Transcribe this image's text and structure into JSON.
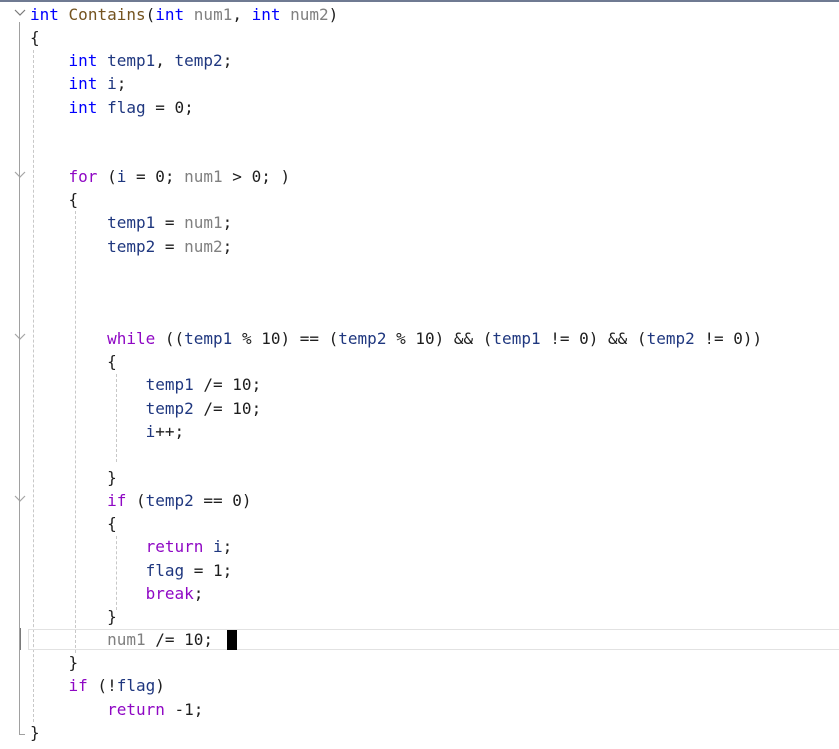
{
  "editor": {
    "colors": {
      "keyword": "#0000ff",
      "control": "#8f08c4",
      "function": "#74531f",
      "parameter": "#808080",
      "local": "#1f377f",
      "text": "#1e1e1e"
    },
    "lines": [
      {
        "tokens": [
          {
            "t": "int",
            "c": "keyword"
          },
          {
            "t": " "
          },
          {
            "t": "Contains",
            "c": "func"
          },
          {
            "t": "("
          },
          {
            "t": "int",
            "c": "keyword"
          },
          {
            "t": " "
          },
          {
            "t": "num1",
            "c": "param"
          },
          {
            "t": ", "
          },
          {
            "t": "int",
            "c": "keyword"
          },
          {
            "t": " "
          },
          {
            "t": "num2",
            "c": "param"
          },
          {
            "t": ")"
          }
        ]
      },
      {
        "tokens": [
          {
            "t": "{"
          }
        ]
      },
      {
        "tokens": [
          {
            "t": "    "
          },
          {
            "t": "int",
            "c": "keyword"
          },
          {
            "t": " "
          },
          {
            "t": "temp1",
            "c": "local"
          },
          {
            "t": ", "
          },
          {
            "t": "temp2",
            "c": "local"
          },
          {
            "t": ";"
          }
        ]
      },
      {
        "tokens": [
          {
            "t": "    "
          },
          {
            "t": "int",
            "c": "keyword"
          },
          {
            "t": " "
          },
          {
            "t": "i",
            "c": "local"
          },
          {
            "t": ";"
          }
        ]
      },
      {
        "tokens": [
          {
            "t": "    "
          },
          {
            "t": "int",
            "c": "keyword"
          },
          {
            "t": " "
          },
          {
            "t": "flag",
            "c": "local"
          },
          {
            "t": " = 0;"
          }
        ]
      },
      {
        "tokens": []
      },
      {
        "tokens": []
      },
      {
        "tokens": [
          {
            "t": "    "
          },
          {
            "t": "for",
            "c": "control"
          },
          {
            "t": " ("
          },
          {
            "t": "i",
            "c": "local"
          },
          {
            "t": " = 0; "
          },
          {
            "t": "num1",
            "c": "param"
          },
          {
            "t": " > 0; )"
          }
        ]
      },
      {
        "tokens": [
          {
            "t": "    {"
          }
        ]
      },
      {
        "tokens": [
          {
            "t": "        "
          },
          {
            "t": "temp1",
            "c": "local"
          },
          {
            "t": " = "
          },
          {
            "t": "num1",
            "c": "param"
          },
          {
            "t": ";"
          }
        ]
      },
      {
        "tokens": [
          {
            "t": "        "
          },
          {
            "t": "temp2",
            "c": "local"
          },
          {
            "t": " = "
          },
          {
            "t": "num2",
            "c": "param"
          },
          {
            "t": ";"
          }
        ]
      },
      {
        "tokens": []
      },
      {
        "tokens": []
      },
      {
        "tokens": []
      },
      {
        "tokens": [
          {
            "t": "        "
          },
          {
            "t": "while",
            "c": "control"
          },
          {
            "t": " (("
          },
          {
            "t": "temp1",
            "c": "local"
          },
          {
            "t": " % 10) == ("
          },
          {
            "t": "temp2",
            "c": "local"
          },
          {
            "t": " % 10) && ("
          },
          {
            "t": "temp1",
            "c": "local"
          },
          {
            "t": " != 0) && ("
          },
          {
            "t": "temp2",
            "c": "local"
          },
          {
            "t": " != 0))"
          }
        ]
      },
      {
        "tokens": [
          {
            "t": "        {"
          }
        ]
      },
      {
        "tokens": [
          {
            "t": "            "
          },
          {
            "t": "temp1",
            "c": "local"
          },
          {
            "t": " /= 10;"
          }
        ]
      },
      {
        "tokens": [
          {
            "t": "            "
          },
          {
            "t": "temp2",
            "c": "local"
          },
          {
            "t": " /= 10;"
          }
        ]
      },
      {
        "tokens": [
          {
            "t": "            "
          },
          {
            "t": "i",
            "c": "local"
          },
          {
            "t": "++;"
          }
        ]
      },
      {
        "tokens": []
      },
      {
        "tokens": [
          {
            "t": "        }"
          }
        ]
      },
      {
        "tokens": [
          {
            "t": "        "
          },
          {
            "t": "if",
            "c": "control"
          },
          {
            "t": " ("
          },
          {
            "t": "temp2",
            "c": "local"
          },
          {
            "t": " == 0)"
          }
        ]
      },
      {
        "tokens": [
          {
            "t": "        {"
          }
        ]
      },
      {
        "tokens": [
          {
            "t": "            "
          },
          {
            "t": "return",
            "c": "control"
          },
          {
            "t": " "
          },
          {
            "t": "i",
            "c": "local"
          },
          {
            "t": ";"
          }
        ]
      },
      {
        "tokens": [
          {
            "t": "            "
          },
          {
            "t": "flag",
            "c": "local"
          },
          {
            "t": " = 1;"
          }
        ]
      },
      {
        "tokens": [
          {
            "t": "            "
          },
          {
            "t": "break",
            "c": "control"
          },
          {
            "t": ";"
          }
        ]
      },
      {
        "tokens": [
          {
            "t": "        }"
          }
        ]
      },
      {
        "tokens": [
          {
            "t": "        "
          },
          {
            "t": "num1",
            "c": "param"
          },
          {
            "t": " /= 10;"
          }
        ]
      },
      {
        "tokens": [
          {
            "t": "    }"
          }
        ]
      },
      {
        "tokens": [
          {
            "t": "    "
          },
          {
            "t": "if",
            "c": "control"
          },
          {
            "t": " (!"
          },
          {
            "t": "flag",
            "c": "local"
          },
          {
            "t": ")"
          }
        ]
      },
      {
        "tokens": [
          {
            "t": "        "
          },
          {
            "t": "return",
            "c": "control"
          },
          {
            "t": " -1;"
          }
        ]
      },
      {
        "tokens": [
          {
            "t": "}"
          }
        ]
      }
    ]
  }
}
